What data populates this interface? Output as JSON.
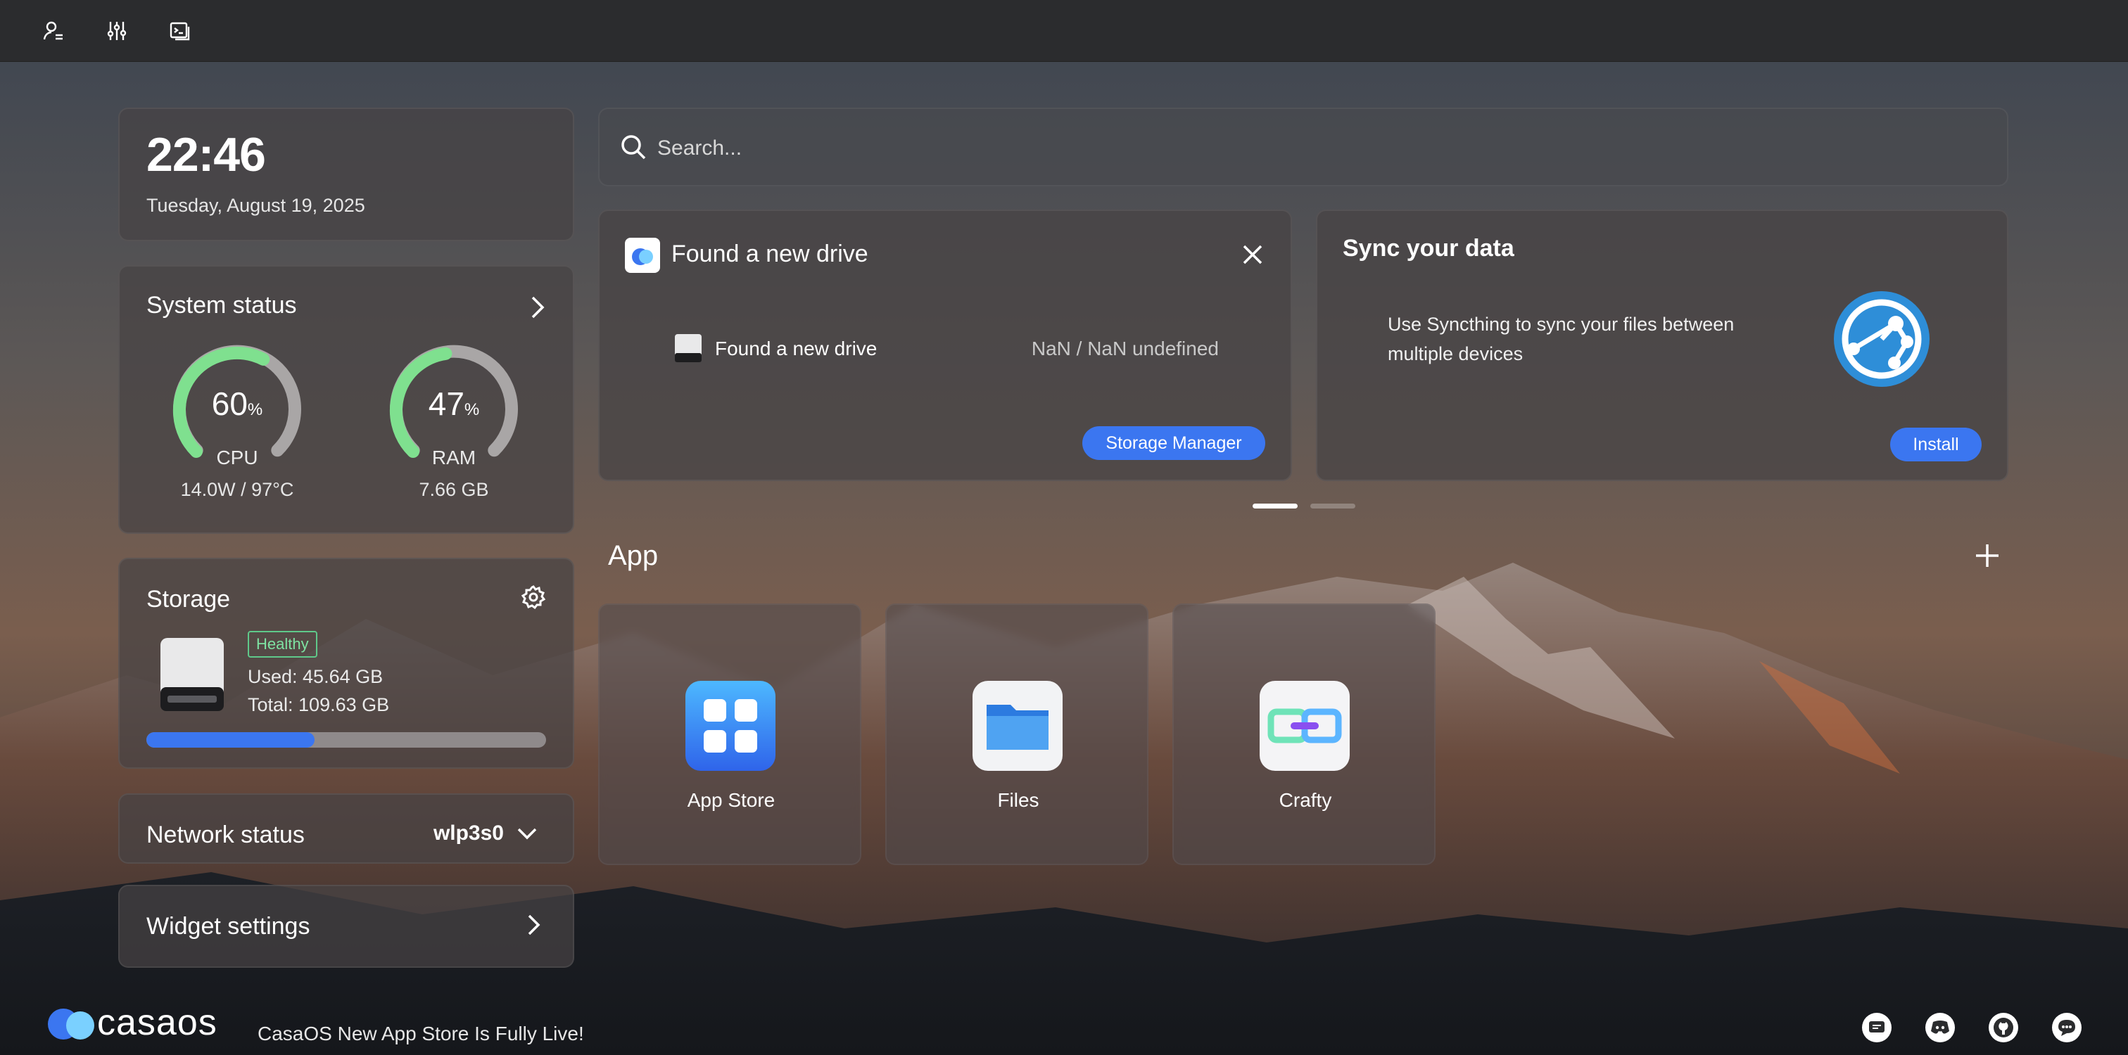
{
  "clock": {
    "time": "22:46",
    "date": "Tuesday, August 19, 2025"
  },
  "system_status": {
    "title": "System status",
    "cpu": {
      "value": "60",
      "unit": "%",
      "percent": 60,
      "label": "CPU",
      "detail": "14.0W / 97°C"
    },
    "ram": {
      "value": "47",
      "unit": "%",
      "percent": 47,
      "label": "RAM",
      "detail": "7.66 GB"
    }
  },
  "storage": {
    "title": "Storage",
    "health": "Healthy",
    "used": "Used: 45.64 GB",
    "total": "Total: 109.63 GB",
    "usage_fraction": 0.42
  },
  "network": {
    "title": "Network status",
    "interface": "wlp3s0"
  },
  "widget_settings": {
    "title": "Widget settings"
  },
  "search": {
    "placeholder": "Search..."
  },
  "drive_card": {
    "title": "Found a new drive",
    "item_name": "Found a new drive",
    "item_size": "NaN / NaN undefined",
    "button": "Storage Manager"
  },
  "sync_card": {
    "title": "Sync your data",
    "text": "Use Syncthing to sync your files between multiple devices",
    "button": "Install"
  },
  "apps": {
    "title": "App",
    "items": [
      {
        "label": "App Store"
      },
      {
        "label": "Files"
      },
      {
        "label": "Crafty"
      }
    ]
  },
  "footer": {
    "logo_text": "casaos",
    "news": "CasaOS New App Store Is Fully Live!"
  },
  "colors": {
    "accent": "#3b76f0",
    "healthy": "#5fc98a",
    "gauge_green": "#7fe08f"
  }
}
